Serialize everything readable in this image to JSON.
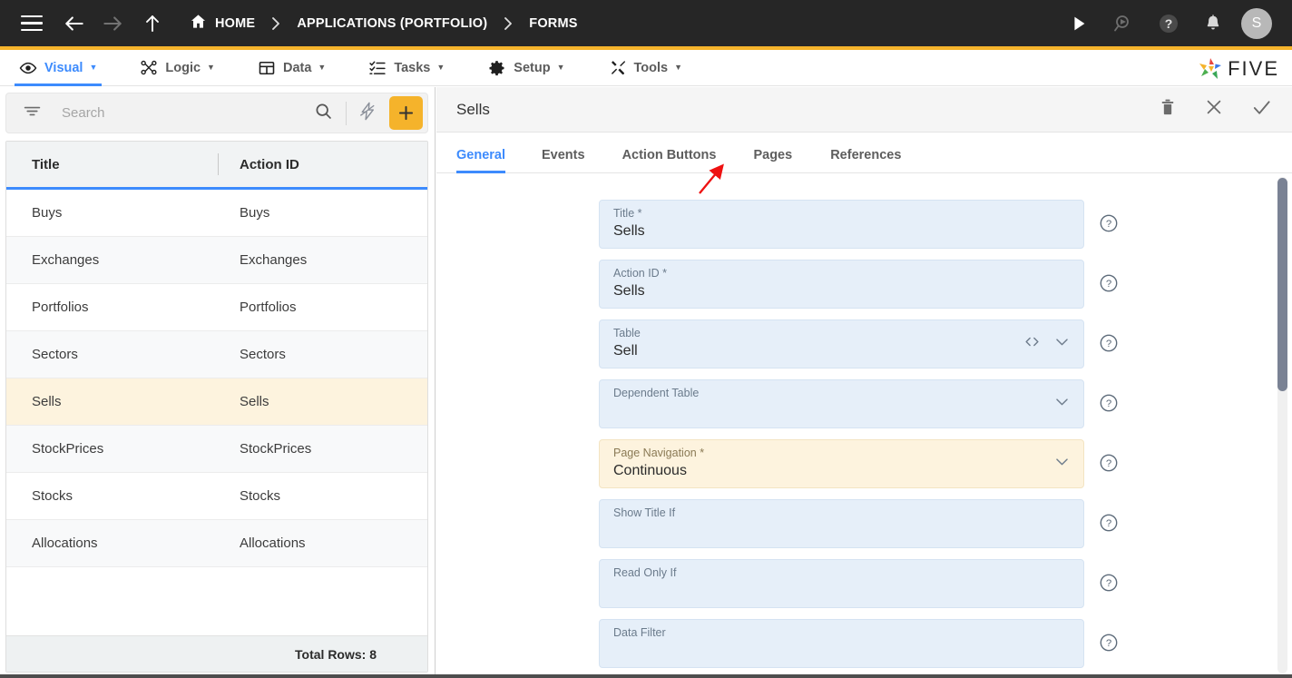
{
  "topbar": {
    "icons": {
      "menu": "hamburger-icon",
      "back": "back-arrow-icon",
      "forward": "forward-arrow-icon",
      "up": "up-arrow-icon",
      "home": "home-icon",
      "run": "play-icon",
      "quick_run": "search-run-icon",
      "help": "help-circle-icon",
      "notifications": "bell-icon"
    },
    "breadcrumb": [
      {
        "label": "HOME",
        "icon": "home-icon"
      },
      {
        "label": "APPLICATIONS (PORTFOLIO)"
      },
      {
        "label": "FORMS"
      }
    ],
    "avatar_initial": "S"
  },
  "menubar": {
    "items": [
      {
        "label": "Visual",
        "icon": "eye-icon",
        "active": true
      },
      {
        "label": "Logic",
        "icon": "nodes-icon",
        "active": false
      },
      {
        "label": "Data",
        "icon": "table-icon",
        "active": false
      },
      {
        "label": "Tasks",
        "icon": "checklist-icon",
        "active": false
      },
      {
        "label": "Setup",
        "icon": "gear-icon",
        "active": false
      },
      {
        "label": "Tools",
        "icon": "tools-icon",
        "active": false
      }
    ],
    "caret": "▼",
    "logo_text": "FIVE"
  },
  "sidebar": {
    "search": {
      "placeholder": "Search",
      "value": ""
    },
    "toolbar": {
      "filter": "filter-icon",
      "search": "search-icon",
      "bolt": "quick-action-icon",
      "add": "+"
    },
    "grid": {
      "columns": [
        "Title",
        "Action ID"
      ],
      "rows": [
        {
          "title": "Buys",
          "action_id": "Buys",
          "selected": false
        },
        {
          "title": "Exchanges",
          "action_id": "Exchanges",
          "selected": false
        },
        {
          "title": "Portfolios",
          "action_id": "Portfolios",
          "selected": false
        },
        {
          "title": "Sectors",
          "action_id": "Sectors",
          "selected": false
        },
        {
          "title": "Sells",
          "action_id": "Sells",
          "selected": true
        },
        {
          "title": "StockPrices",
          "action_id": "StockPrices",
          "selected": false
        },
        {
          "title": "Stocks",
          "action_id": "Stocks",
          "selected": false
        },
        {
          "title": "Allocations",
          "action_id": "Allocations",
          "selected": false
        }
      ],
      "footer": "Total Rows: 8"
    }
  },
  "detail": {
    "title": "Sells",
    "header_actions": [
      {
        "name": "delete-button",
        "icon": "trash-icon"
      },
      {
        "name": "cancel-button",
        "icon": "close-icon"
      },
      {
        "name": "save-button",
        "icon": "check-icon"
      }
    ],
    "tabs": [
      {
        "label": "General",
        "active": true
      },
      {
        "label": "Events",
        "active": false
      },
      {
        "label": "Action Buttons",
        "active": false
      },
      {
        "label": "Pages",
        "active": false
      },
      {
        "label": "References",
        "active": false
      }
    ],
    "fields": [
      {
        "label": "Title *",
        "value": "Sells",
        "highlight": false,
        "controls": []
      },
      {
        "label": "Action ID *",
        "value": "Sells",
        "highlight": false,
        "controls": []
      },
      {
        "label": "Table",
        "value": "Sell",
        "highlight": false,
        "controls": [
          "code-icon",
          "chevron-down-icon"
        ]
      },
      {
        "label": "Dependent Table",
        "value": "",
        "highlight": false,
        "controls": [
          "chevron-down-icon"
        ]
      },
      {
        "label": "Page Navigation *",
        "value": "Continuous",
        "highlight": true,
        "controls": [
          "chevron-down-icon"
        ]
      },
      {
        "label": "Show Title If",
        "value": "",
        "highlight": false,
        "controls": []
      },
      {
        "label": "Read Only If",
        "value": "",
        "highlight": false,
        "controls": []
      },
      {
        "label": "Data Filter",
        "value": "",
        "highlight": false,
        "controls": []
      }
    ],
    "help_icon": "help-circle-icon",
    "annotation": {
      "type": "red-arrow",
      "points_to": "Pages"
    }
  },
  "colors": {
    "accent_yellow": "#f5b32b",
    "accent_blue": "#3d8bfd",
    "topbar_dark": "#262626",
    "field_blue": "#e6eff9",
    "field_highlight": "#fdf3de",
    "annotation_red": "#ee1111"
  }
}
